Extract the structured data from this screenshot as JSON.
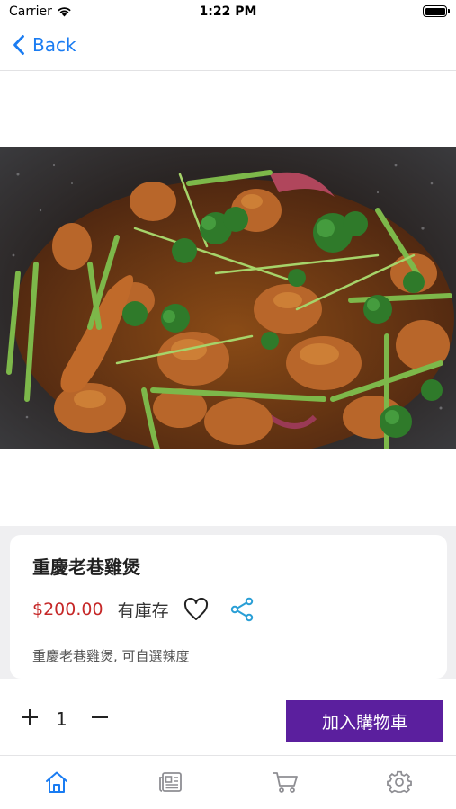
{
  "status_bar": {
    "carrier": "Carrier",
    "time": "1:22 PM",
    "battery_level": 1.0
  },
  "nav": {
    "back_label": "Back",
    "back_icon": "chevron-left-icon"
  },
  "product": {
    "name": "重慶老巷雞煲",
    "price": "$200.00",
    "stock": "有庫存",
    "description": "重慶老巷雞煲, 可自選辣度",
    "image": "dish-photo-chicken-pot"
  },
  "cart": {
    "plus_symbol": "+",
    "quantity": "1",
    "minus_symbol": "−",
    "add_label": "加入購物車"
  },
  "tabs": [
    {
      "name": "home",
      "icon": "home-icon",
      "active": true
    },
    {
      "name": "news",
      "icon": "newspaper-icon",
      "active": false
    },
    {
      "name": "cart",
      "icon": "cart-icon",
      "active": false
    },
    {
      "name": "settings",
      "icon": "gear-icon",
      "active": false
    }
  ],
  "colors": {
    "accent": "#1a7cf2",
    "price": "#c62828",
    "button": "#5b1f9e",
    "share": "#2a9fd6",
    "tab_inactive": "#8e8e93"
  }
}
